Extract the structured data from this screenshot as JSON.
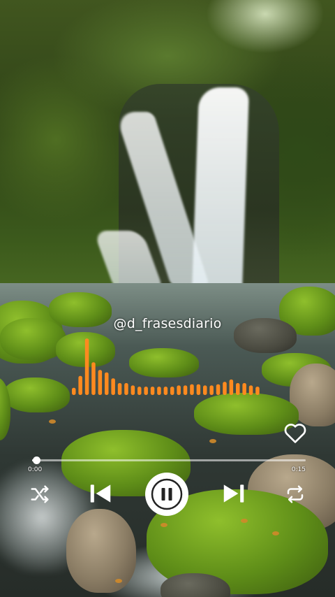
{
  "overlay": {
    "watermark": "@d_frasesdiario",
    "accent_color": "#ff8a1f"
  },
  "equalizer": {
    "levels": [
      0.12,
      0.32,
      0.95,
      0.55,
      0.42,
      0.38,
      0.28,
      0.2,
      0.2,
      0.16,
      0.14,
      0.14,
      0.14,
      0.14,
      0.14,
      0.14,
      0.16,
      0.16,
      0.18,
      0.18,
      0.16,
      0.16,
      0.18,
      0.22,
      0.26,
      0.2,
      0.2,
      0.16,
      0.14
    ]
  },
  "player": {
    "current_time": "0:00",
    "total_time": "0:15",
    "progress": 0.01,
    "like_icon": "heart-outline-icon",
    "controls": [
      "shuffle-icon",
      "previous-icon",
      "pause-icon",
      "next-icon",
      "repeat-icon"
    ]
  }
}
